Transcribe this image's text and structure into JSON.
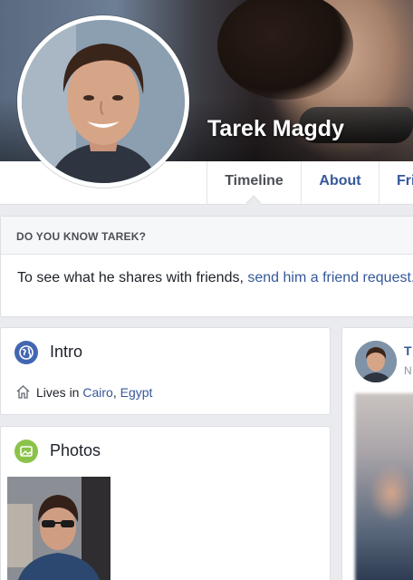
{
  "profile": {
    "name": "Tarek Magdy"
  },
  "tabs": [
    {
      "label": "Timeline",
      "active": true
    },
    {
      "label": "About",
      "active": false
    },
    {
      "label": "Fri",
      "active": false
    }
  ],
  "know": {
    "heading": "DO YOU KNOW TAREK?",
    "text": "To see what he shares with friends, ",
    "link": "send him a friend request."
  },
  "intro": {
    "title": "Intro",
    "lives_prefix": "Lives in ",
    "city": "Cairo",
    "separator": ", ",
    "country": "Egypt"
  },
  "photos": {
    "title": "Photos"
  },
  "post": {
    "name_partial": "T",
    "sub_partial": "N"
  },
  "colors": {
    "link": "#365899",
    "background": "#e9ebee",
    "intro_icon": "#4267b2",
    "photos_icon": "#8bc34a"
  },
  "icons": {
    "intro": "globe-icon",
    "photos": "photos-icon",
    "lives": "home-icon"
  }
}
